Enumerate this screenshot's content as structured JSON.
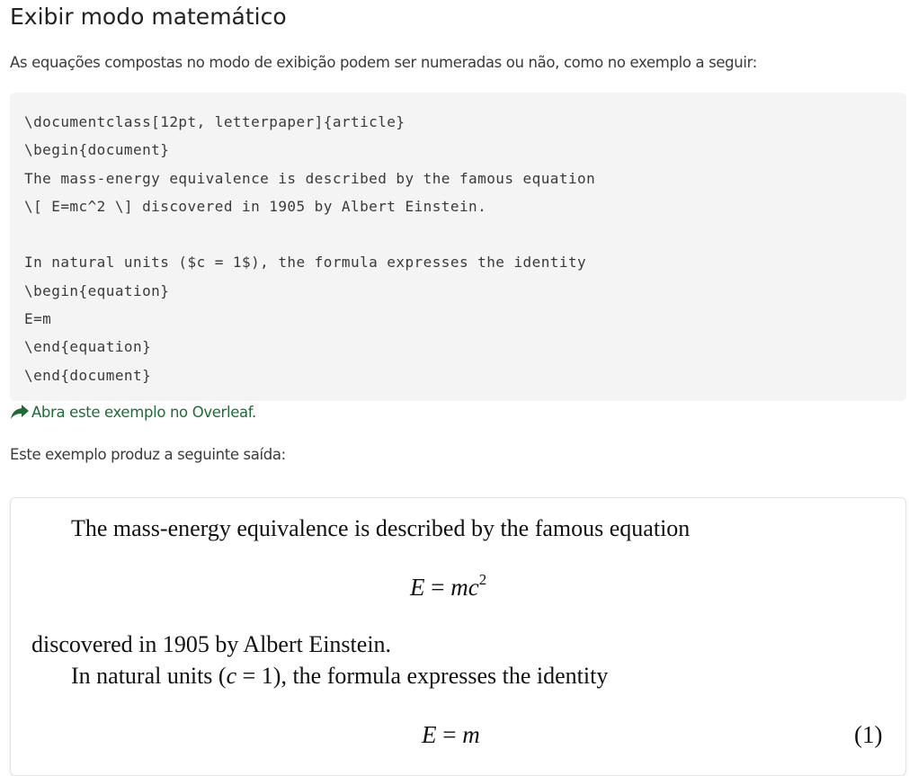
{
  "heading": "Exibir modo matemático",
  "intro": "As equações compostas no modo de exibição podem ser numeradas ou não, como no exemplo a seguir:",
  "code_lines": [
    "\\documentclass[12pt, letterpaper]{article}",
    "\\begin{document}",
    "The mass-energy equivalence is described by the famous equation",
    "\\[ E=mc^2 \\] discovered in 1905 by Albert Einstein.",
    "",
    "In natural units ($c = 1$), the formula expresses the identity",
    "\\begin{equation}",
    "E=m",
    "\\end{equation}",
    "\\end{document}"
  ],
  "overleaf_link": "Abra este exemplo no Overleaf.",
  "output_intro": "Este exemplo produz a seguinte saída:",
  "output": {
    "para1": "The mass-energy equivalence is described by the famous equation",
    "eq1": {
      "lhs": "E",
      "eqsign": "=",
      "rhs_var": "mc",
      "sup": "2"
    },
    "para2": "discovered in 1905 by Albert Einstein.",
    "para3_pre": "In natural units (",
    "para3_var": "c",
    "para3_eq": " = 1), the formula expresses the identity",
    "eq2": {
      "lhs": "E",
      "eqsign": "=",
      "rhs_var": "m"
    },
    "eq2_number": "(1)"
  },
  "colors": {
    "code_bg": "#f4f4f4",
    "link": "#1f6b38"
  },
  "icons": {
    "link_icon": "share-arrow-icon"
  }
}
